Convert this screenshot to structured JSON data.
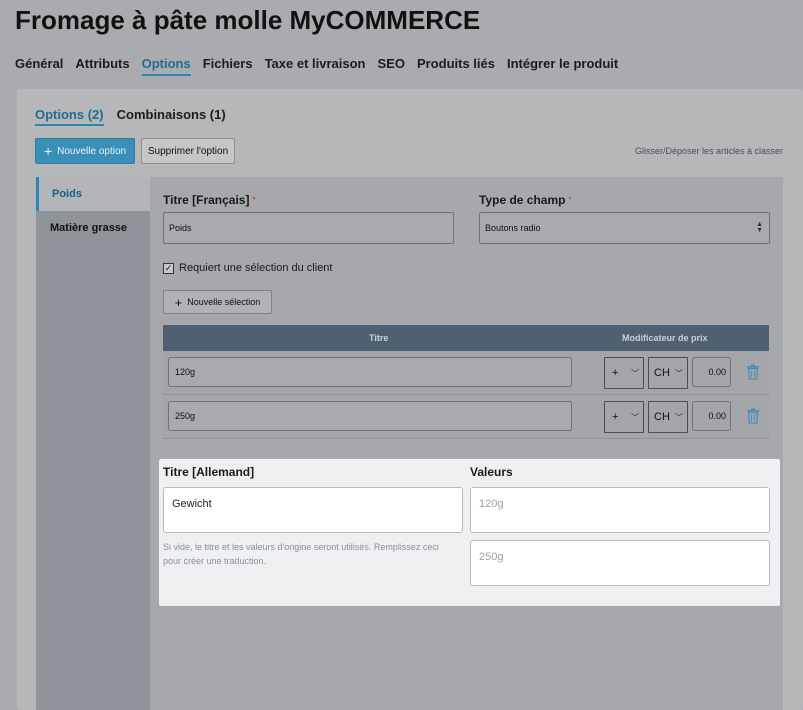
{
  "page": {
    "title": "Fromage à pâte molle MyCOMMERCE"
  },
  "main_tabs": [
    {
      "label": "Général",
      "active": false
    },
    {
      "label": "Attributs",
      "active": false
    },
    {
      "label": "Options",
      "active": true
    },
    {
      "label": "Fichiers",
      "active": false
    },
    {
      "label": "Taxe et livraison",
      "active": false
    },
    {
      "label": "SEO",
      "active": false
    },
    {
      "label": "Produits liés",
      "active": false
    },
    {
      "label": "Intégrer le produit",
      "active": false
    }
  ],
  "sub_tabs": [
    {
      "label": "Options (2)",
      "active": true
    },
    {
      "label": "Combinaisons (1)",
      "active": false
    }
  ],
  "toolbar": {
    "new_option_label": "Nouvelle option",
    "delete_option_label": "Supprimer l'option",
    "drag_hint": "Glisser/Déposer les articles à classer"
  },
  "options_list": [
    {
      "label": "Poids",
      "active": true
    },
    {
      "label": "Matière grasse",
      "active": false
    }
  ],
  "option_form": {
    "title_label": "Titre [Français]",
    "title_value": "Poids",
    "field_type_label": "Type de champ",
    "field_type_value": "Boutons radio",
    "required_mark": "•",
    "require_selection_label": "Requiert une sélection du client",
    "require_selection_checked": "☑",
    "new_selection_label": "Nouvelle sélection",
    "table_headers": {
      "title": "Titre",
      "price_modifier": "Modificateur de prix"
    },
    "selections": [
      {
        "name": "120g",
        "sign": "+",
        "currency": "CH",
        "amount": "0.00"
      },
      {
        "name": "250g",
        "sign": "+",
        "currency": "CH",
        "amount": "0.00"
      }
    ]
  },
  "translation": {
    "title_label": "Titre [Allemand]",
    "title_value": "Gewicht",
    "values_label": "Valeurs",
    "value_placeholders": [
      "120g",
      "250g"
    ],
    "help_text": "Si vide, le titre et les valeurs d'origine seront utilisés. Remplissez ceci pour créer une traduction."
  },
  "colors": {
    "accent": "#2b86b5",
    "table_header": "#4e6072",
    "trash": "#4a8fb8"
  }
}
